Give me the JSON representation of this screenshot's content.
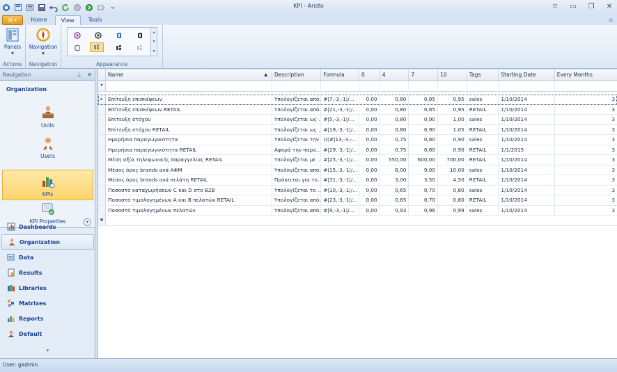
{
  "window": {
    "title": "KPI - Aristo"
  },
  "ribbon": {
    "tabs": [
      {
        "label": "Home",
        "active": false
      },
      {
        "label": "View",
        "active": true
      },
      {
        "label": "Tools",
        "active": false
      }
    ],
    "groups": {
      "actions": {
        "label": "Actions",
        "panels_label": "Panels"
      },
      "navigation": {
        "label": "Navigation",
        "navigation_label": "Navigation"
      },
      "appearance": {
        "label": "Appearance"
      }
    }
  },
  "nav": {
    "header": "Navigation",
    "section_title": "Organization",
    "items": [
      {
        "label": "Units",
        "icon": "person-at-desk-icon",
        "selected": false
      },
      {
        "label": "Users",
        "icon": "user-icon",
        "selected": false
      },
      {
        "label": "KPIs",
        "icon": "bar-chart-icon",
        "selected": true
      },
      {
        "label": "KPI Properties",
        "icon": "kpi-properties-icon",
        "selected": false
      }
    ],
    "groups": [
      {
        "label": "Dashboards",
        "selected": false
      },
      {
        "label": "Organization",
        "selected": true
      },
      {
        "label": "Data",
        "selected": false
      },
      {
        "label": "Results",
        "selected": false
      },
      {
        "label": "Libraries",
        "selected": false
      },
      {
        "label": "Matrixes",
        "selected": false
      },
      {
        "label": "Reports",
        "selected": false
      },
      {
        "label": "Default",
        "selected": false
      }
    ]
  },
  "grid": {
    "columns": [
      "Name",
      "Description",
      "Formula",
      "0",
      "4",
      "7",
      "10",
      "Tags",
      "Starting Date",
      "Every Months"
    ],
    "rows": [
      [
        "Επίτευξη επισκέψεων",
        "Υπολογίζεται από...",
        "#|7,-3,-1|/...",
        "0,00",
        "0,80",
        "0,85",
        "0,95",
        "sales",
        "1/10/2014",
        "3"
      ],
      [
        "Επίτευξη επισκέψεων RETAIL",
        "Υπολογίζεται από...",
        "#|21,-3,-1|/...",
        "0,00",
        "0,80",
        "0,85",
        "0,95",
        "RETAIL",
        "1/10/2014",
        "3"
      ],
      [
        "Επίτευξη στόχου",
        "Υπολογίζεται ως ...",
        "#|5,-3,-1|/...",
        "0,00",
        "0,80",
        "0,90",
        "1,00",
        "sales",
        "1/10/2014",
        "3"
      ],
      [
        "Επίτευξη στόχου RETAIL",
        "Υπολογίζεται ως ...",
        "#|19,-3,-1|/...",
        "0,00",
        "0,80",
        "0,90",
        "1,05",
        "RETAIL",
        "1/10/2014",
        "3"
      ],
      [
        "Ημερήσια παραγωγικότητα",
        "Υπολογίζεται την η...",
        "(((#|13,-3,-...",
        "0,00",
        "0,75",
        "0,80",
        "0,90",
        "sales",
        "1/10/2014",
        "3"
      ],
      [
        "Ημερήσια παραγωγικότητα RETAIL",
        "Αφορά την παρα...",
        "#|29,-3,-1|/...",
        "0,00",
        "0,75",
        "0,80",
        "0,90",
        "RETAIL",
        "1/1/2015",
        "3"
      ],
      [
        "Μέση αξία τηλεφωνικής παραγγελίας RETAIL",
        "Υπολογίζεται με ...",
        "#|25,-3,-1|/...",
        "0,00",
        "550,00",
        "600,00",
        "700,00",
        "RETAIL",
        "1/10/2014",
        "3"
      ],
      [
        "Μέσος όρος brands ανά ΑΦΜ",
        "Υπολογίζεται από...",
        "#|15,-3,-1|/...",
        "0,00",
        "8,00",
        "9,00",
        "10,00",
        "sales",
        "1/10/2014",
        "3"
      ],
      [
        "Μέσος όρος brands ανά πελάτη RETAIL",
        "Πρόκειται για το...",
        "#|31,-3,-1|/...",
        "0,00",
        "3,00",
        "3,50",
        "4,50",
        "RETAIL",
        "1/10/2014",
        "3"
      ],
      [
        "Ποσοστό καταχωρήσεων C και D στο B2B",
        "Υπολογίζεται το ...",
        "#|10,-3,-1|/...",
        "0,00",
        "0,65",
        "0,70",
        "0,80",
        "sales",
        "1/10/2014",
        "3"
      ],
      [
        "Ποσοστό τιμολογημένων A και B πελατών RETAIL",
        "Υπολογίζεται από...",
        "#|23,-3,-1|/...",
        "0,00",
        "0,65",
        "0,70",
        "0,80",
        "RETAIL",
        "1/10/2014",
        "3"
      ],
      [
        "Ποσοστό τιμολογημένων πελατών",
        "Υπολογίζεται από...",
        "#|9,-3,-1|/...",
        "0,00",
        "0,93",
        "0,96",
        "0,99",
        "sales",
        "1/10/2014",
        "3"
      ]
    ]
  },
  "status": {
    "text": "User: gadmin"
  },
  "colors": {
    "accent": "#15428b",
    "selection": "#fbd46b"
  }
}
